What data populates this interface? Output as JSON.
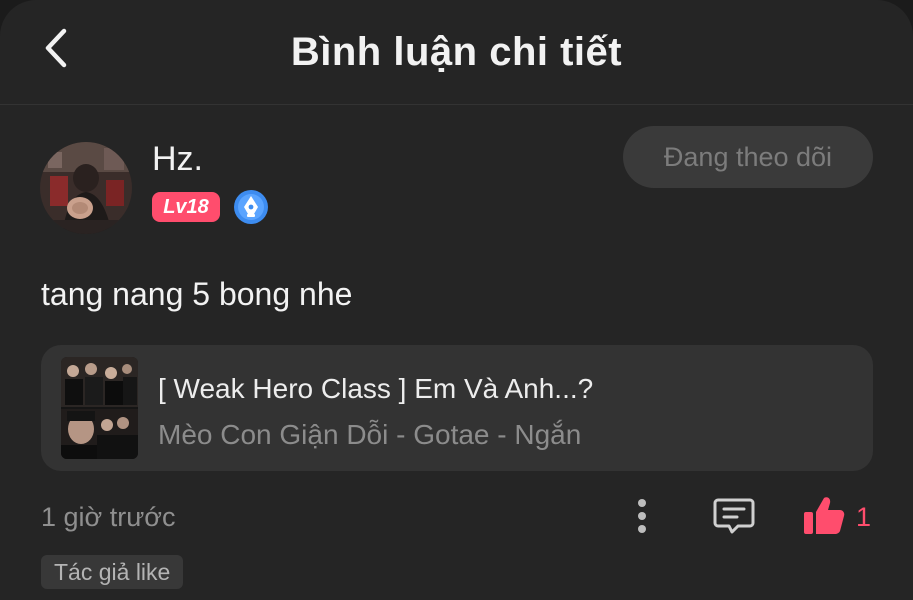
{
  "header": {
    "title": "Bình luận chi tiết",
    "back_icon": "chevron-left-icon"
  },
  "user": {
    "name": "Hz.",
    "level": "Lv18",
    "level_color": "#ff4d6d",
    "writer_badge_icon": "pen-nib-icon",
    "follow_label": "Đang theo dõi"
  },
  "comment": {
    "text": "tang nang 5 bong nhe",
    "time": "1 giờ trước",
    "like_count": "1",
    "author_like_tag": "Tác giả like"
  },
  "story": {
    "title": "[ Weak Hero Class ] Em Và Anh...?",
    "meta": "Mèo Con Giận Dỗi - Gotae - Ngắn"
  },
  "actions": {
    "more_icon": "more-vertical-icon",
    "reply_icon": "comment-icon",
    "like_icon": "thumbs-up-icon"
  },
  "colors": {
    "background": "#252525",
    "accent": "#ff4d6d",
    "text_primary": "#f2f2f2",
    "text_secondary": "#8f8f8f"
  }
}
